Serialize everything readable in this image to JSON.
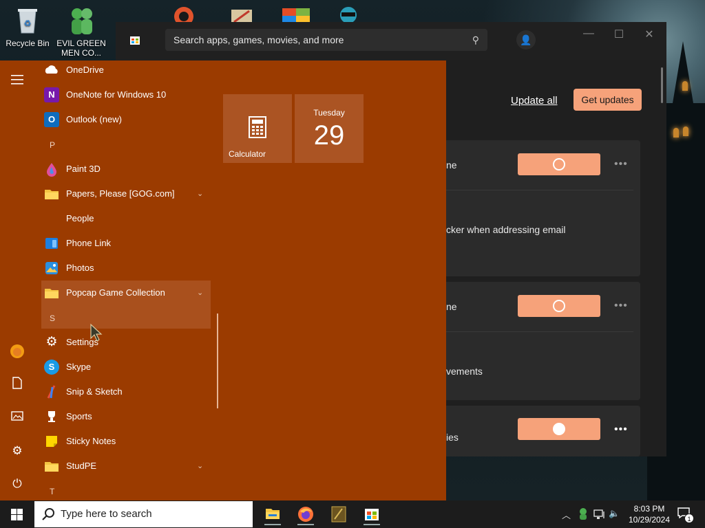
{
  "desktop": {
    "icons": [
      {
        "label": "Recycle Bin",
        "icon": "recycle-bin-icon"
      },
      {
        "label": "EVIL GREEN MEN CO...",
        "icon": "green-men-icon"
      }
    ],
    "top_partial_icons": [
      "pdf-app-icon",
      "app-icon",
      "office-icon",
      "character-icon"
    ]
  },
  "store": {
    "search_placeholder": "Search apps, games, movies, and more",
    "update_all": "Update all",
    "get_updates": "Get updates",
    "cards": [
      {
        "title_partial": "ne",
        "detail_partial": "cker when addressing email"
      },
      {
        "title_partial": "ne",
        "detail_partial": "vements"
      },
      {
        "title_partial": "ies"
      }
    ],
    "more_glyph": "•••",
    "accent": "#f6a27a"
  },
  "start_menu": {
    "background": "#9b3b00",
    "apps": [
      {
        "label": "OneDrive",
        "icon": "onedrive-icon"
      },
      {
        "label": "OneNote for Windows 10",
        "icon": "onenote-icon"
      },
      {
        "label": "Outlook (new)",
        "icon": "outlook-icon"
      },
      {
        "letter": "P"
      },
      {
        "label": "Paint 3D",
        "icon": "paint3d-icon"
      },
      {
        "label": "Papers, Please [GOG.com]",
        "icon": "folder-icon",
        "expandable": true
      },
      {
        "label": "People",
        "icon": "people-icon"
      },
      {
        "label": "Phone Link",
        "icon": "phone-link-icon"
      },
      {
        "label": "Photos",
        "icon": "photos-icon"
      },
      {
        "label": "Popcap Game Collection",
        "icon": "folder-icon",
        "expandable": true
      },
      {
        "letter": "S"
      },
      {
        "label": "Settings",
        "icon": "gear-icon"
      },
      {
        "label": "Skype",
        "icon": "skype-icon"
      },
      {
        "label": "Snip & Sketch",
        "icon": "snip-sketch-icon"
      },
      {
        "label": "Sports",
        "icon": "trophy-icon"
      },
      {
        "label": "Sticky Notes",
        "icon": "sticky-notes-icon"
      },
      {
        "label": "StudPE",
        "icon": "folder-icon",
        "expandable": true
      },
      {
        "letter": "T"
      }
    ],
    "tiles": {
      "calculator": {
        "label": "Calculator",
        "icon": "calculator-icon"
      },
      "calendar": {
        "day": "Tuesday",
        "date": "29"
      }
    },
    "rail_icons": [
      "hamburger-menu-icon",
      "user-avatar-icon",
      "documents-icon",
      "pictures-icon",
      "settings-icon",
      "power-icon"
    ]
  },
  "taskbar": {
    "search_placeholder": "Type here to search",
    "pinned": [
      "file-explorer-icon",
      "firefox-icon",
      "game-app-icon",
      "store-icon"
    ],
    "clock": {
      "time": "8:03 PM",
      "date": "10/29/2024"
    },
    "notification_count": "1"
  }
}
